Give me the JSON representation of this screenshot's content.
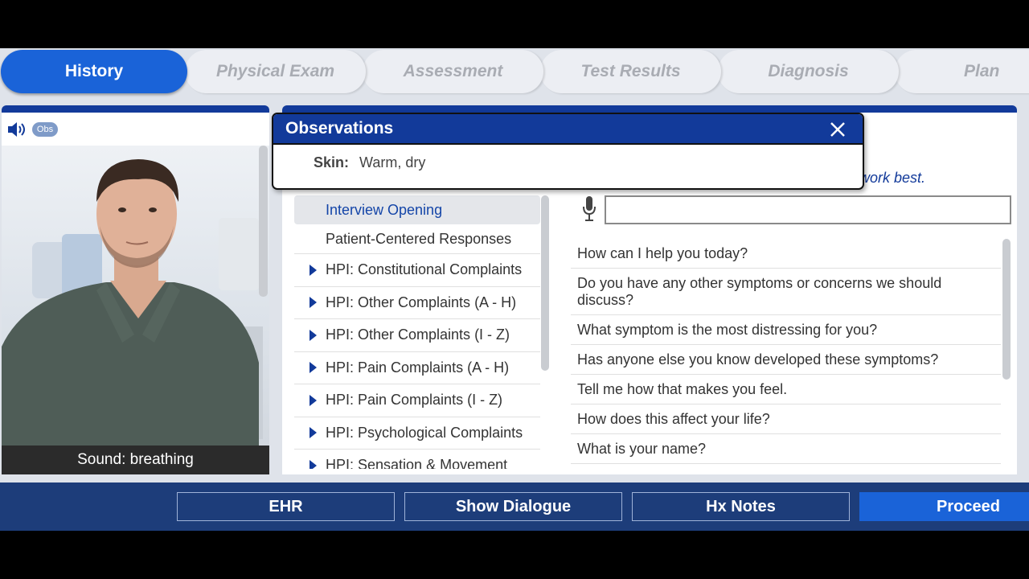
{
  "tabs": [
    {
      "label": "History",
      "active": true
    },
    {
      "label": "Physical Exam",
      "active": false
    },
    {
      "label": "Assessment",
      "active": false
    },
    {
      "label": "Test Results",
      "active": false
    },
    {
      "label": "Diagnosis",
      "active": false
    },
    {
      "label": "Plan",
      "active": false
    }
  ],
  "left_panel": {
    "obs_badge": "Obs",
    "sound_caption": "Sound: breathing"
  },
  "observations": {
    "title": "Observations",
    "label": "Skin:",
    "value": "Warm, dry"
  },
  "main": {
    "hint_text": "work best.",
    "categories": [
      {
        "label": "Interview Opening",
        "expandable": false,
        "selected": true
      },
      {
        "label": "Patient-Centered Responses",
        "expandable": false,
        "selected": false
      },
      {
        "label": "HPI: Constitutional Complaints",
        "expandable": true,
        "selected": false
      },
      {
        "label": "HPI: Other Complaints (A - H)",
        "expandable": true,
        "selected": false
      },
      {
        "label": "HPI: Other Complaints (I - Z)",
        "expandable": true,
        "selected": false
      },
      {
        "label": "HPI: Pain Complaints (A - H)",
        "expandable": true,
        "selected": false
      },
      {
        "label": "HPI: Pain Complaints (I - Z)",
        "expandable": true,
        "selected": false
      },
      {
        "label": "HPI: Psychological Complaints",
        "expandable": true,
        "selected": false
      },
      {
        "label": "HPI: Sensation & Movement",
        "expandable": true,
        "selected": false
      }
    ],
    "question_input": {
      "value": ""
    },
    "questions": [
      "How can I help you today?",
      "Do you have any other symptoms or concerns we should discuss?",
      "What symptom is the most distressing for you?",
      "Has anyone else you know developed these symptoms?",
      "Tell me how that makes you feel.",
      "How does this affect your life?",
      "What is your name?"
    ]
  },
  "bottom_bar": {
    "ehr": "EHR",
    "show_dialogue": "Show Dialogue",
    "hx_notes": "Hx Notes",
    "proceed": "Proceed"
  },
  "colors": {
    "accent": "#1a63d8",
    "navy": "#123a9a",
    "bottom_bar": "#1d3d7a"
  }
}
